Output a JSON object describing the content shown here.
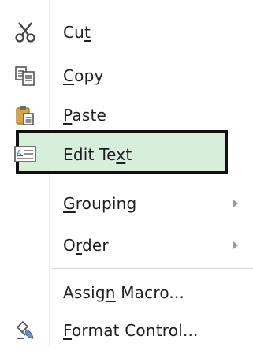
{
  "menu": {
    "items": [
      {
        "pre": "Cu",
        "ul": "t",
        "post": "",
        "icon": "scissors-icon",
        "submenu": false
      },
      {
        "pre": "",
        "ul": "C",
        "post": "opy",
        "icon": "copy-icon",
        "submenu": false
      },
      {
        "pre": "",
        "ul": "P",
        "post": "aste",
        "icon": "paste-icon",
        "submenu": false
      },
      {
        "pre": "Edit Te",
        "ul": "x",
        "post": "t",
        "icon": "edit-text-icon",
        "submenu": false,
        "highlighted": true
      },
      {
        "pre": "",
        "ul": "G",
        "post": "rouping",
        "icon": "",
        "submenu": true
      },
      {
        "pre": "O",
        "ul": "r",
        "post": "der",
        "icon": "",
        "submenu": true
      },
      {
        "pre": "Assig",
        "ul": "n",
        "post": " Macro...",
        "icon": "",
        "submenu": false
      },
      {
        "pre": "",
        "ul": "F",
        "post": "ormat Control...",
        "icon": "format-control-icon",
        "submenu": false
      }
    ]
  },
  "colors": {
    "highlight_fill": "#d7eedb",
    "highlight_border": "#111111"
  }
}
